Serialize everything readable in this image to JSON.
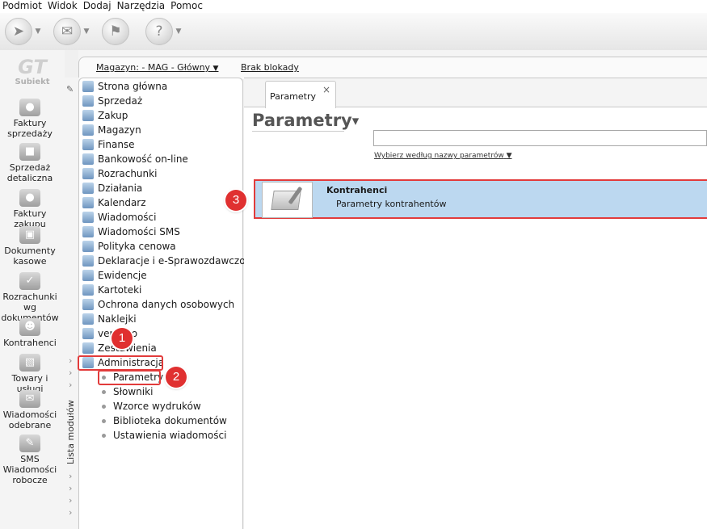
{
  "menu": [
    "Podmiot",
    "Widok",
    "Dodaj",
    "Narzędzia",
    "Pomoc"
  ],
  "toolbar": {
    "buttons": [
      {
        "icon": "send-mail-icon"
      },
      {
        "icon": "receive-mail-icon"
      },
      {
        "icon": "tasks-icon"
      },
      {
        "icon": "help-icon"
      }
    ]
  },
  "logo": {
    "name": "Subiekt"
  },
  "leftbar": [
    {
      "label": "Faktury sprzedaży",
      "icon": "coins-icon"
    },
    {
      "label": "Sprzedaż detaliczna",
      "icon": "register-icon"
    },
    {
      "label": "Faktury zakupu",
      "icon": "coins-stack-icon"
    },
    {
      "label": "Dokumenty kasowe",
      "icon": "cash-icon"
    },
    {
      "label": "Rozrachunki wg dokumentów",
      "icon": "settlements-icon"
    },
    {
      "label": "Kontrahenci",
      "icon": "person-icon"
    },
    {
      "label": "Towary i usługi",
      "icon": "goods-icon"
    },
    {
      "label": "Wiadomości odebrane",
      "icon": "mail-icon"
    },
    {
      "label": "SMS Wiadomości robocze",
      "icon": "sms-icon"
    }
  ],
  "module_strip_label": "Lista modułów",
  "topbar": {
    "magazyn": "Magazyn: - MAG - Główny",
    "blokada": "Brak blokady"
  },
  "modules": [
    "Strona główna",
    "Sprzedaż",
    "Zakup",
    "Magazyn",
    "Finanse",
    "Bankowość on-line",
    "Rozrachunki",
    "Działania",
    "Kalendarz",
    "Wiadomości",
    "Wiadomości SMS",
    "Polityka cenowa",
    "Deklaracje i e-Sprawozdawczość",
    "Ewidencje",
    "Kartoteki",
    "Ochrona danych osobowych",
    "Naklejki",
    "vendero",
    "Zestawienia",
    "Administracja"
  ],
  "submodules": [
    "Parametry",
    "Słowniki",
    "Wzorce wydruków",
    "Biblioteka dokumentów",
    "Ustawienia wiadomości"
  ],
  "tab": {
    "label": "Parametry",
    "close": "×"
  },
  "page": {
    "title": "Parametry",
    "search_placeholder": "",
    "filter_label": "Wybierz według nazwy parametrów"
  },
  "card": {
    "title": "Kontrahenci",
    "subtitle": "Parametry kontrahentów"
  },
  "badges": [
    "1",
    "2",
    "3"
  ],
  "colors": {
    "highlight": "#e23b3b",
    "selection": "#bcd8f0"
  }
}
